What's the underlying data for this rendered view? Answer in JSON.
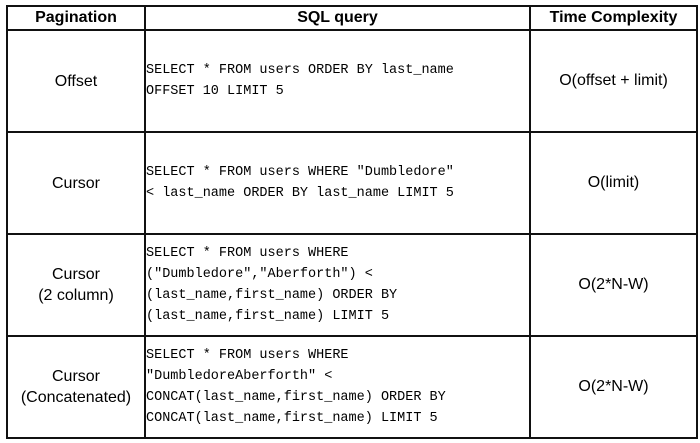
{
  "headers": {
    "pagination": "Pagination",
    "sql_query": "SQL query",
    "time_complexity": "Time Complexity"
  },
  "rows": [
    {
      "pagination": [
        "Offset"
      ],
      "sql": [
        "SELECT * FROM users ORDER BY last_name",
        "OFFSET 10 LIMIT 5"
      ],
      "complexity": "O(offset + limit)"
    },
    {
      "pagination": [
        "Cursor"
      ],
      "sql": [
        "SELECT * FROM users WHERE \"Dumbledore\"",
        "< last_name ORDER BY last_name LIMIT 5"
      ],
      "complexity": "O(limit)"
    },
    {
      "pagination": [
        "Cursor",
        "(2 column)"
      ],
      "sql": [
        "SELECT * FROM users WHERE",
        "(\"Dumbledore\",\"Aberforth\") <",
        "(last_name,first_name) ORDER BY",
        "(last_name,first_name) LIMIT 5"
      ],
      "complexity": "O(2*N-W)"
    },
    {
      "pagination": [
        "Cursor",
        "(Concatenated)"
      ],
      "sql": [
        "SELECT * FROM users WHERE",
        "\"DumbledoreAberforth\" <",
        "CONCAT(last_name,first_name) ORDER BY",
        "CONCAT(last_name,first_name) LIMIT 5"
      ],
      "complexity": "O(2*N-W)"
    }
  ]
}
